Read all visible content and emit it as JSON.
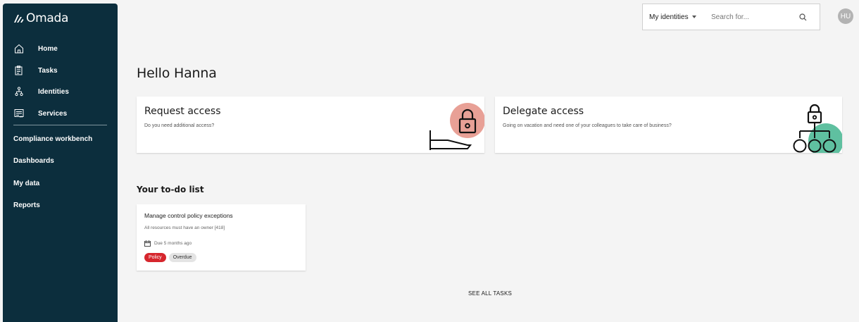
{
  "app": {
    "logo_text": "Omada"
  },
  "sidebar": {
    "items": [
      {
        "label": "Home",
        "icon": "home-icon"
      },
      {
        "label": "Tasks",
        "icon": "tasks-icon"
      },
      {
        "label": "Identities",
        "icon": "identities-icon"
      },
      {
        "label": "Services",
        "icon": "services-icon"
      }
    ],
    "links": [
      "Compliance workbench",
      "Dashboards",
      "My data",
      "Reports"
    ]
  },
  "header": {
    "filter_label": "My identities",
    "search_placeholder": "Search for...",
    "avatar_initials": "HU"
  },
  "main": {
    "greeting": "Hello Hanna",
    "cards": [
      {
        "title": "Request access",
        "subtitle": "Do you need additional access?",
        "icon": "lock-hand-icon"
      },
      {
        "title": "Delegate access",
        "subtitle": "Going on vacation and need one of your colleagues to take care of business?",
        "icon": "lock-hierarchy-icon"
      }
    ],
    "todo_heading": "Your to-do list",
    "tasks": [
      {
        "title": "Manage control policy exceptions",
        "subtitle": "All resources must have an owner [418]",
        "due": "Due 5 months ago",
        "badges": [
          "Policy",
          "Overdue"
        ]
      }
    ],
    "see_all": "SEE ALL TASKS"
  },
  "colors": {
    "sidebar_bg": "#0c2e3d",
    "request_accent": "#e8a096",
    "delegate_accent": "#5fc0a0",
    "policy_badge": "#d6262d"
  }
}
